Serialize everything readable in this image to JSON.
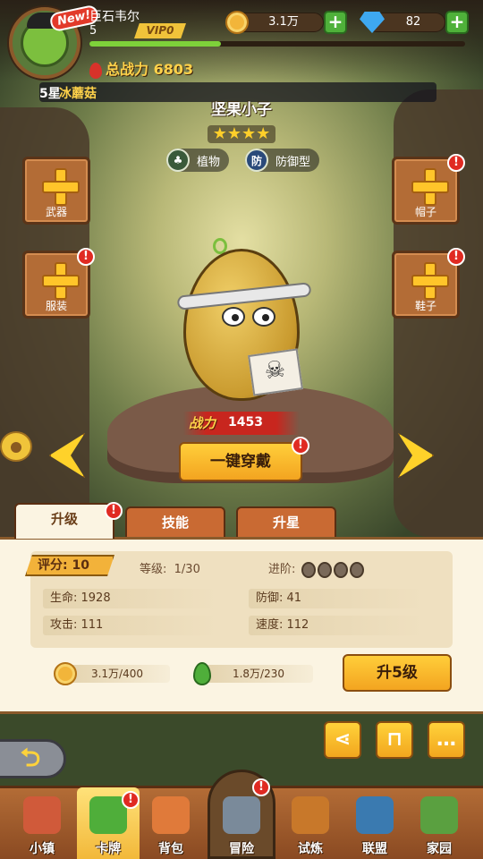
{
  "player": {
    "name": "巨石韦尔",
    "level": "5",
    "vip": "VIP0",
    "new_badge": "New!",
    "xp_fraction": 0.35,
    "total_power_label": "总战力",
    "total_power": "6803"
  },
  "currency": {
    "coins": "3.1万",
    "gems": "82"
  },
  "plant": {
    "notice_prefix": "5星",
    "notice_name": "冰蘑菇",
    "name": "坚果小子",
    "stars": "★★★★",
    "type_label": "植物",
    "role_icon_text": "防",
    "role_label": "防御型",
    "battle_label": "战力",
    "battle_value": "1453"
  },
  "equipment": {
    "weapon": "武器",
    "clothes": "服装",
    "hat": "帽子",
    "shoes": "鞋子",
    "badge": "!"
  },
  "equip_all_label": "一键穿戴",
  "tabs": [
    "升级",
    "技能",
    "升星"
  ],
  "stats": {
    "score_label": "评分:",
    "score": "10",
    "level_label": "等级:",
    "level": "1/30",
    "advance_label": "进阶:",
    "hp": "生命: 1928",
    "defense": "防御: 41",
    "attack": "攻击: 111",
    "speed": "速度: 112"
  },
  "cost": {
    "coins": "3.1万/400",
    "seeds": "1.8万/230"
  },
  "level_up_label": "升5级",
  "nav": [
    {
      "label": "小镇",
      "color": "#d05a3a"
    },
    {
      "label": "卡牌",
      "color": "#4fae3a"
    },
    {
      "label": "背包",
      "color": "#e07a3a"
    },
    {
      "label": "冒险",
      "color": "#7a8a9a"
    },
    {
      "label": "试炼",
      "color": "#c8782a"
    },
    {
      "label": "联盟",
      "color": "#3a7ab0"
    },
    {
      "label": "家园",
      "color": "#5aa040"
    }
  ]
}
